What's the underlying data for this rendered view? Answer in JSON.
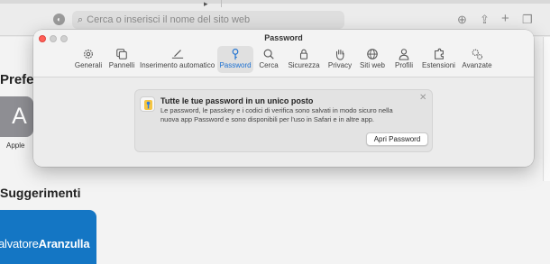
{
  "browser": {
    "address_placeholder": "Cerca o inserisci il nome del sito web"
  },
  "background_page": {
    "favorites_title": "Preferi",
    "favorite_tile_letter": "A",
    "favorite_tile_label": "Apple",
    "suggestions_title": "Suggerimenti",
    "suggestion_card_text_regular": "alvatore",
    "suggestion_card_text_bold": "Aranzulla",
    "suggestion_card_color": "#1476c4"
  },
  "prefs_window": {
    "title": "Password",
    "tabs": [
      {
        "label": "Generali",
        "icon": "gear-icon"
      },
      {
        "label": "Pannelli",
        "icon": "tabs-icon"
      },
      {
        "label": "Inserimento automatico",
        "icon": "pencil-field-icon"
      },
      {
        "label": "Password",
        "icon": "key-icon",
        "active": true
      },
      {
        "label": "Cerca",
        "icon": "search-icon"
      },
      {
        "label": "Sicurezza",
        "icon": "lock-icon"
      },
      {
        "label": "Privacy",
        "icon": "hand-icon"
      },
      {
        "label": "Siti web",
        "icon": "globe-icon"
      },
      {
        "label": "Profili",
        "icon": "person-icon"
      },
      {
        "label": "Estensioni",
        "icon": "puzzle-icon"
      },
      {
        "label": "Avanzate",
        "icon": "gears-icon"
      }
    ],
    "active_color": "#1a6fd1",
    "info_card": {
      "title": "Tutte le tue password in un unico posto",
      "description": "Le password, le passkey e i codici di verifica sono salvati in modo sicuro nella nuova app Password e sono disponibili per l'uso in Safari e in altre app.",
      "button_label": "Apri Password"
    }
  }
}
